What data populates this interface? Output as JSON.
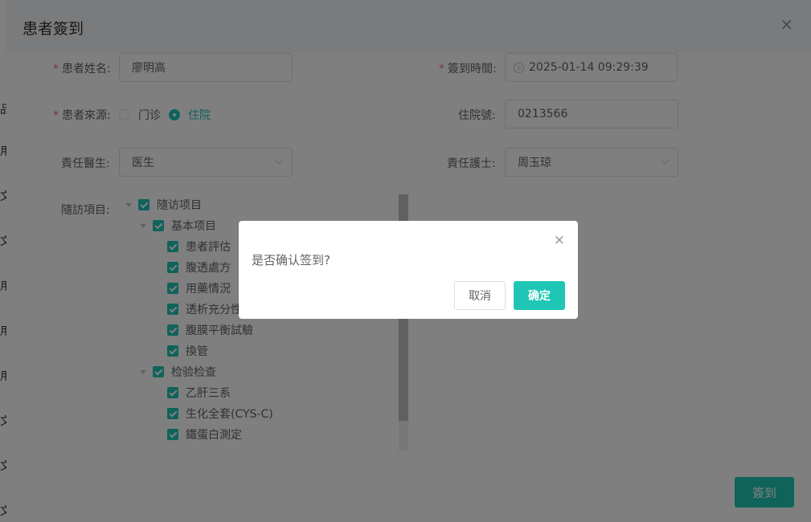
{
  "background_glyphs": [
    "品",
    "用",
    "文",
    "文",
    "用",
    "用",
    "用",
    "文",
    "文",
    "文"
  ],
  "dialog": {
    "title": "患者簽到",
    "close_icon": "×",
    "patient_name_label": "患者姓名:",
    "patient_name_value": "廖明高",
    "checkin_time_label": "簽到時間:",
    "checkin_time_value": "2025-01-14 09:29:39",
    "source_label": "患者來源:",
    "source_options": [
      "门诊",
      "住院"
    ],
    "source_selected": "住院",
    "admission_no_label": "住院號:",
    "admission_no_value": "0213566",
    "doctor_label": "責任醫生:",
    "doctor_value": "医生",
    "nurse_label": "責任護士:",
    "nurse_value": "周玉琼",
    "followup_label": "隨訪項目:",
    "tree": {
      "root": "隨访项目",
      "groups": [
        {
          "label": "基本项目",
          "items": [
            "患者評估",
            "腹透處方",
            "用藥情況",
            "透析充分性",
            "腹膜平衡試驗",
            "換管"
          ]
        },
        {
          "label": "检验检查",
          "items": [
            "乙肝三系",
            "生化全套(CYS-C)",
            "鐵蛋白測定"
          ]
        }
      ]
    },
    "submit_label": "簽到"
  },
  "confirm": {
    "close_icon": "×",
    "message": "是否确认签到?",
    "cancel_label": "取消",
    "ok_label": "确定"
  },
  "colors": {
    "accent": "#1fc6b6",
    "required": "#f56c6c"
  }
}
